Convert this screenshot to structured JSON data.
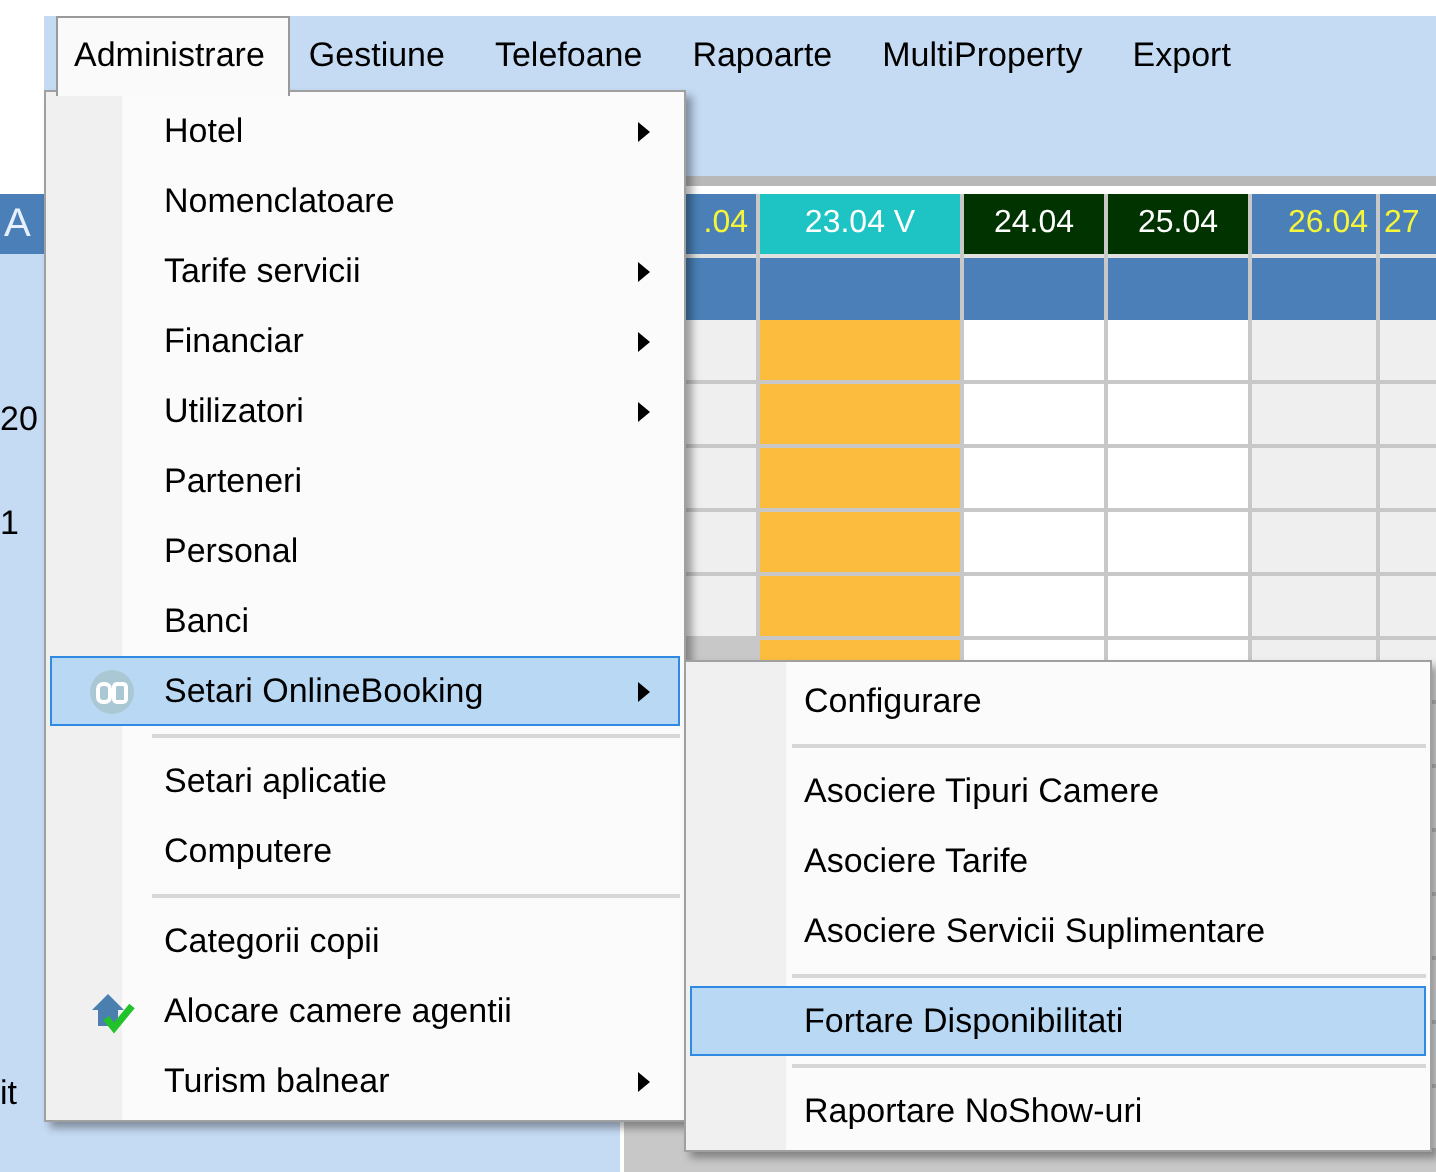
{
  "menubar": [
    {
      "label": "Administrare",
      "selected": true
    },
    {
      "label": "Gestiune",
      "selected": false
    },
    {
      "label": "Telefoane",
      "selected": false
    },
    {
      "label": "Rapoarte",
      "selected": false
    },
    {
      "label": "MultiProperty",
      "selected": false
    },
    {
      "label": "Export",
      "selected": false
    }
  ],
  "left_pane": {
    "header": "A",
    "texts": [
      {
        "text": "20"
      },
      {
        "text": "1"
      },
      {
        "text": "it"
      }
    ]
  },
  "grid": {
    "columns": [
      {
        "label": ".04",
        "kind": "plain"
      },
      {
        "label": "23.04 V",
        "kind": "current"
      },
      {
        "label": "24.04",
        "kind": "dark"
      },
      {
        "label": "25.04",
        "kind": "dark"
      },
      {
        "label": "26.04",
        "kind": "plain"
      },
      {
        "label": "27",
        "kind": "plain"
      }
    ]
  },
  "menu": {
    "items": [
      {
        "kind": "item",
        "label": "Hotel",
        "submenu": true,
        "selected": false
      },
      {
        "kind": "item",
        "label": "Nomenclatoare",
        "submenu": false,
        "selected": false
      },
      {
        "kind": "item",
        "label": "Tarife servicii",
        "submenu": true,
        "selected": false
      },
      {
        "kind": "item",
        "label": "Financiar",
        "submenu": true,
        "selected": false
      },
      {
        "kind": "item",
        "label": "Utilizatori",
        "submenu": true,
        "selected": false
      },
      {
        "kind": "item",
        "label": "Parteneri",
        "submenu": false,
        "selected": false
      },
      {
        "kind": "item",
        "label": "Personal",
        "submenu": false,
        "selected": false
      },
      {
        "kind": "item",
        "label": "Banci",
        "submenu": false,
        "selected": false
      },
      {
        "kind": "badge",
        "label": "Setari OnlineBooking",
        "submenu": true,
        "selected": true
      },
      {
        "kind": "separator"
      },
      {
        "kind": "item",
        "label": "Setari aplicatie",
        "submenu": false,
        "selected": false
      },
      {
        "kind": "item",
        "label": "Computere",
        "submenu": false,
        "selected": false
      },
      {
        "kind": "separator"
      },
      {
        "kind": "item",
        "label": "Categorii copii",
        "submenu": false,
        "selected": false
      },
      {
        "kind": "house",
        "label": "Alocare camere agentii",
        "submenu": false,
        "selected": false
      },
      {
        "kind": "item",
        "label": "Turism balnear",
        "submenu": true,
        "selected": false
      }
    ]
  },
  "submenu": {
    "items": [
      {
        "kind": "item",
        "label": "Configurare",
        "submenu": false,
        "selected": false
      },
      {
        "kind": "separator"
      },
      {
        "kind": "item",
        "label": "Asociere Tipuri Camere",
        "submenu": false,
        "selected": false
      },
      {
        "kind": "item",
        "label": "Asociere Tarife",
        "submenu": false,
        "selected": false
      },
      {
        "kind": "item",
        "label": "Asociere Servicii Suplimentare",
        "submenu": false,
        "selected": false
      },
      {
        "kind": "separator"
      },
      {
        "kind": "item",
        "label": "Fortare Disponibilitati",
        "submenu": false,
        "selected": true
      },
      {
        "kind": "separator"
      },
      {
        "kind": "item",
        "label": "Raportare NoShow-uri",
        "submenu": false,
        "selected": false
      }
    ]
  }
}
